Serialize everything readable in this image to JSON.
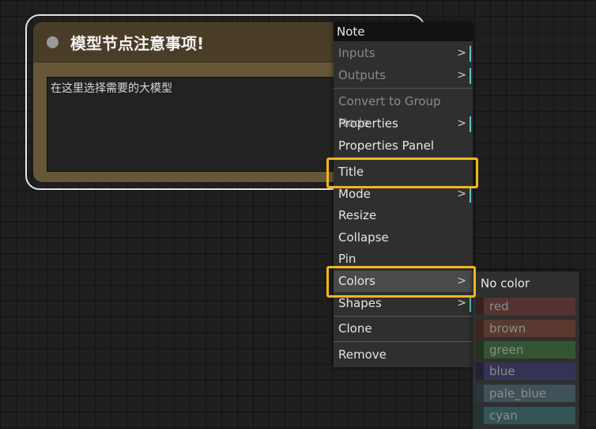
{
  "node": {
    "title": "模型节点注意事项!",
    "text": "在这里选择需要的大模型"
  },
  "context_menu": {
    "header": "Note",
    "items": [
      {
        "label": "Inputs",
        "submenu_arrow": ">",
        "disabled": true
      },
      {
        "label": "Outputs",
        "submenu_arrow": ">",
        "disabled": true
      },
      {
        "label": "Convert to Group Node",
        "disabled": true
      },
      {
        "label": "Properties",
        "submenu_arrow": ">"
      },
      {
        "label": "Properties Panel"
      },
      {
        "label": "Title",
        "annotated": true
      },
      {
        "label": "Mode",
        "submenu_arrow": ">"
      },
      {
        "label": "Resize"
      },
      {
        "label": "Collapse"
      },
      {
        "label": "Pin"
      },
      {
        "label": "Colors",
        "submenu_arrow": ">",
        "highlighted": true,
        "annotated": true
      },
      {
        "label": "Shapes",
        "submenu_arrow": ">"
      },
      {
        "label": "Clone"
      },
      {
        "label": "Remove"
      }
    ]
  },
  "colors_submenu": {
    "no_color": "No color",
    "options": [
      {
        "label": "red",
        "color": "#553333",
        "edge": "#332222"
      },
      {
        "label": "brown",
        "color": "#593930",
        "edge": "#3e2723"
      },
      {
        "label": "green",
        "color": "#335533",
        "edge": "#223322"
      },
      {
        "label": "blue",
        "color": "#333355",
        "edge": "#222233"
      },
      {
        "label": "pale_blue",
        "color": "#3f5159",
        "edge": "#2a363b"
      },
      {
        "label": "cyan",
        "color": "#335555",
        "edge": "#223333"
      }
    ]
  },
  "annotation_color": "#f3b51b"
}
